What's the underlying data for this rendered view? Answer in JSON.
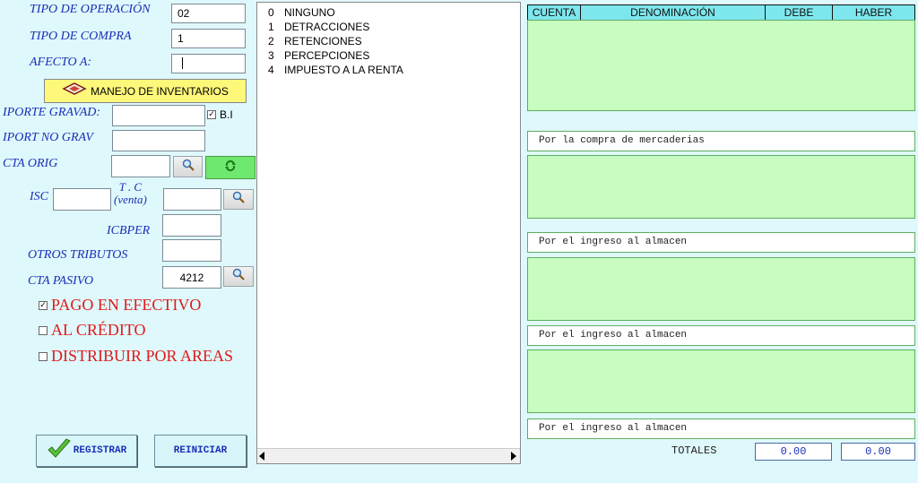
{
  "form": {
    "tipo_operacion_label": "TIPO DE OPERACIÓN",
    "tipo_operacion_value": "02",
    "tipo_compra_label": "TIPO DE COMPRA",
    "tipo_compra_value": "1",
    "afecto_label": "AFECTO A:",
    "afecto_value": "",
    "manejo_inventarios_label": "MANEJO DE INVENTARIOS",
    "importe_gravado_label": "IPORTE GRAVAD:",
    "importe_gravado_value": "",
    "bi_label": "B.I",
    "bi_checked": true,
    "importe_no_grav_label": "IPORT NO GRAV",
    "importe_no_grav_value": "",
    "cta_orig_label": "CTA ORIG",
    "cta_orig_value": "",
    "isc_label": "ISC",
    "isc_value": "",
    "tc_label_line1": "T . C",
    "tc_label_line2": "(venta)",
    "tc_value": "",
    "icbper_label": "ICBPER",
    "icbper_value": "",
    "otros_tributos_label": "OTROS TRIBUTOS",
    "otros_tributos_value": "",
    "cta_pasivo_label": "CTA PASIVO",
    "cta_pasivo_value": "4212"
  },
  "options": {
    "pago_efectivo_label": "PAGO EN EFECTIVO",
    "pago_efectivo_checked": true,
    "al_credito_label": "AL CRÉDITO",
    "al_credito_checked": false,
    "distribuir_label": "DISTRIBUIR POR AREAS",
    "distribuir_checked": false
  },
  "buttons": {
    "registrar_label": "REGISTRAR",
    "reiniciar_label": "REINICIAR"
  },
  "list": {
    "items": [
      {
        "num": "0",
        "label": "NINGUNO"
      },
      {
        "num": "1",
        "label": "DETRACCIONES"
      },
      {
        "num": "2",
        "label": "RETENCIONES"
      },
      {
        "num": "3",
        "label": "PERCEPCIONES"
      },
      {
        "num": "4",
        "label": "IMPUESTO A LA RENTA"
      }
    ]
  },
  "table": {
    "headers": [
      "CUENTA",
      "DENOMINACIÓN",
      "DEBE",
      "HABER"
    ],
    "descriptions": [
      "Por la compra de mercaderias",
      "Por el ingreso al almacen",
      "Por el ingreso al almacen",
      "Por el ingreso al almacen"
    ],
    "totales_label": "TOTALES",
    "total_debe": "0.00",
    "total_haber": "0.00"
  },
  "colors": {
    "background": "#dff8fb",
    "label_blue": "#1a2fb8",
    "option_red": "#e01a1a",
    "grid_green": "#c8fcc0",
    "header_cyan": "#7de7ed",
    "button_yellow": "#fdf77a"
  },
  "icons": {
    "search": "magnifier-icon",
    "refresh": "refresh-icon",
    "inventory": "inventory-icon",
    "check": "checkmark-icon"
  }
}
